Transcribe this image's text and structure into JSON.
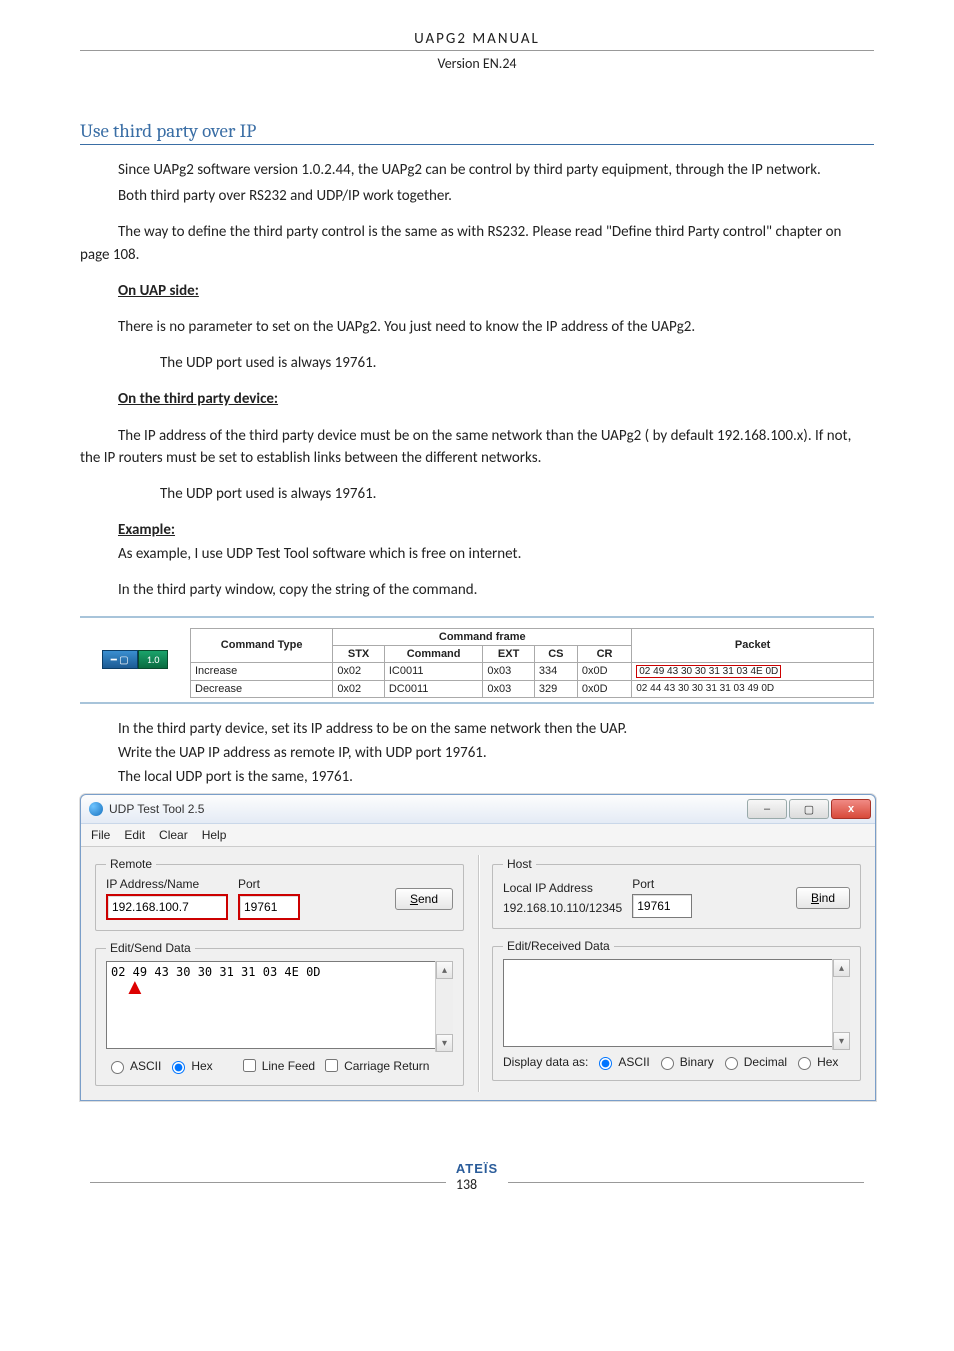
{
  "header": {
    "title": "UAPG2  MANUAL",
    "version": "Version EN.24"
  },
  "section_title": "Use third party over IP",
  "paras": {
    "p1": "Since UAPg2 software version 1.0.2.44, the UAPg2 can be control by third party equipment, through the IP network.",
    "p2": "Both third party over RS232 and UDP/IP work together.",
    "p3": "The way to define the third party control is the same as with RS232. Please read \"Define third Party control\" chapter on page 108.",
    "h1": "On UAP side:",
    "p4": "There is no parameter to set on the UAPg2. You just need to know the IP address of the UAPg2.",
    "p5": "The UDP port used is always 19761.",
    "h2": "On the third party device:",
    "p6": "The IP address of the third party device must be on the same network than the UAPg2 ( by default 192.168.100.x). If not, the IP routers must be set to establish links between the different networks.",
    "p7": "The UDP port used is always 19761.",
    "h3": "Example:",
    "p8": "As example, I use UDP Test Tool software which is free on internet.",
    "p9": "In the third party window, copy the string of the command.",
    "p10": "In the third party device, set its IP address to be on the same network then the UAP.",
    "p11": "Write the UAP IP address as remote IP, with UDP port 19761.",
    "p12": "The local UDP port is the same, 19761."
  },
  "device_chip": {
    "label": "",
    "value": "1.0"
  },
  "cmd_table": {
    "group_frame": "Command frame",
    "headers": [
      "Command Type",
      "STX",
      "Command",
      "EXT",
      "CS",
      "CR",
      "Packet"
    ],
    "rows": [
      {
        "type": "Increase",
        "stx": "0x02",
        "cmd": "IC0011",
        "ext": "0x03",
        "cs": "334",
        "cr": "0x0D",
        "packet": "02 49 43 30 30 31 31 03 4E 0D"
      },
      {
        "type": "Decrease",
        "stx": "0x02",
        "cmd": "DC0011",
        "ext": "0x03",
        "cs": "329",
        "cr": "0x0D",
        "packet": "02 44 43 30 30 31 31 03 49 0D"
      }
    ]
  },
  "udp_tool": {
    "title": "UDP Test Tool 2.5",
    "menu": [
      "File",
      "Edit",
      "Clear",
      "Help"
    ],
    "remote": {
      "legend": "Remote",
      "ip_legend": "IP Address/Name",
      "ip": "192.168.100.7",
      "port_legend": "Port",
      "port": "19761",
      "send": "Send",
      "send_mn": "S"
    },
    "host": {
      "legend": "Host",
      "ip_legend": "Local IP Address",
      "ip": "192.168.10.110/12345",
      "port_legend": "Port",
      "port": "19761",
      "bind": "Bind",
      "bind_mn": "B"
    },
    "send_data": {
      "legend": "Edit/Send Data",
      "value": "02 49 43 30 30 31 31 03 4E 0D",
      "ascii": "ASCII",
      "hex": "Hex",
      "linefeed": "Line Feed",
      "cr": "Carriage Return"
    },
    "recv_data": {
      "legend": "Edit/Received Data",
      "display_as": "Display data as:",
      "ascii": "ASCII",
      "binary": "Binary",
      "decimal": "Decimal",
      "hex": "Hex"
    }
  },
  "footer": {
    "brand": "ATEÏS",
    "page": "138"
  }
}
